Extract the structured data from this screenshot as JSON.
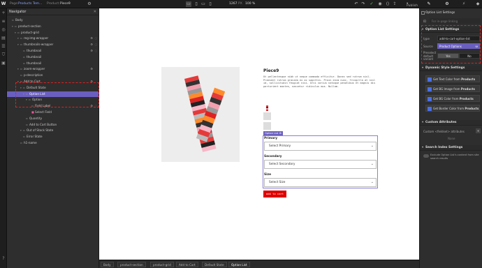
{
  "topbar": {
    "page_label": "Page:",
    "page_value": "Products Tem...",
    "product_label": "Product:",
    "product_value": "Piece9",
    "width_value": "1267",
    "width_unit": "PX",
    "zoom_value": "100 %",
    "publish_label": "Publish"
  },
  "navigator": {
    "title": "Navigator",
    "rows": [
      {
        "label": "Body",
        "depth": 0
      },
      {
        "label": "product-section",
        "depth": 1
      },
      {
        "label": "product-grid",
        "depth": 2
      },
      {
        "label": "reg-img-wrapper",
        "depth": 3
      },
      {
        "label": "thumbnails-wrapper",
        "depth": 3
      },
      {
        "label": "thumbnail",
        "depth": 4
      },
      {
        "label": "thumbnail",
        "depth": 4
      },
      {
        "label": "thumbnail",
        "depth": 4
      },
      {
        "label": "zoom-wrapper",
        "depth": 3
      },
      {
        "label": "p-description",
        "depth": 3
      },
      {
        "label": "Add to Cart",
        "depth": 3
      },
      {
        "label": "Default State",
        "depth": 4
      },
      {
        "label": "Option List",
        "depth": 5
      },
      {
        "label": "Option",
        "depth": 6
      },
      {
        "label": "Field Label",
        "depth": 7
      },
      {
        "label": "Select Field",
        "depth": 7
      },
      {
        "label": "Quantity",
        "depth": 5
      },
      {
        "label": "Add to Cart Button",
        "depth": 5
      },
      {
        "label": "Out of Stock State",
        "depth": 4
      },
      {
        "label": "Error State",
        "depth": 4
      },
      {
        "label": "h1-name",
        "depth": 3
      }
    ]
  },
  "product": {
    "title": "Piece9",
    "description": "Ut pellentesque nibh ut neque commodo efficitur. Donec sed rutrum nisl. Praesent rutrum gravida ex ac sagittis. Proin enim nunc, fringilla at nisl id, sollicitudin feugiat nisi. Orci varius natoque penatibus et magnis dis parturient montes, nascetur ridiculus mus. Nullam.",
    "option_list_tag": "Option List",
    "fields": [
      {
        "label": "Primary",
        "placeholder": "Select Primary"
      },
      {
        "label": "Secondary",
        "placeholder": "Select Secondary"
      },
      {
        "label": "Size",
        "placeholder": "Select Size"
      }
    ],
    "add_to_cart": "add to cart"
  },
  "breadcrumb": [
    "Body",
    "product-section",
    "product-grid",
    "Add to Cart",
    "Default State",
    "Option List"
  ],
  "settings": {
    "header": "Option List Settings",
    "id_label": "ID",
    "id_placeholder": "For in-page linking",
    "section_title": "Option List Settings",
    "type_label": "type",
    "type_value": "add-to-cart-option-list",
    "source_label": "Source",
    "source_value": "Product Options",
    "preselect_label": "Preselect default variant",
    "yes": "Yes",
    "no": "No",
    "dynamic_title": "Dynamic Style Settings",
    "dynamic_buttons": [
      {
        "label": "Get Text Color from",
        "source": "Products"
      },
      {
        "label": "Get BG Image from",
        "source": "Products"
      },
      {
        "label": "Get BG Color from",
        "source": "Products"
      },
      {
        "label": "Get Border Color from",
        "source": "Products"
      }
    ],
    "custom_title": "Custom Attributes",
    "custom_label": "Custom <fieldset> attributes",
    "custom_value": "None",
    "search_title": "Search Index Settings",
    "search_text": "Exclude Option List's content from site search results"
  },
  "colors": {
    "accent": "#6a5fbf",
    "highlight": "#e02020",
    "button_red": "#e00000"
  }
}
